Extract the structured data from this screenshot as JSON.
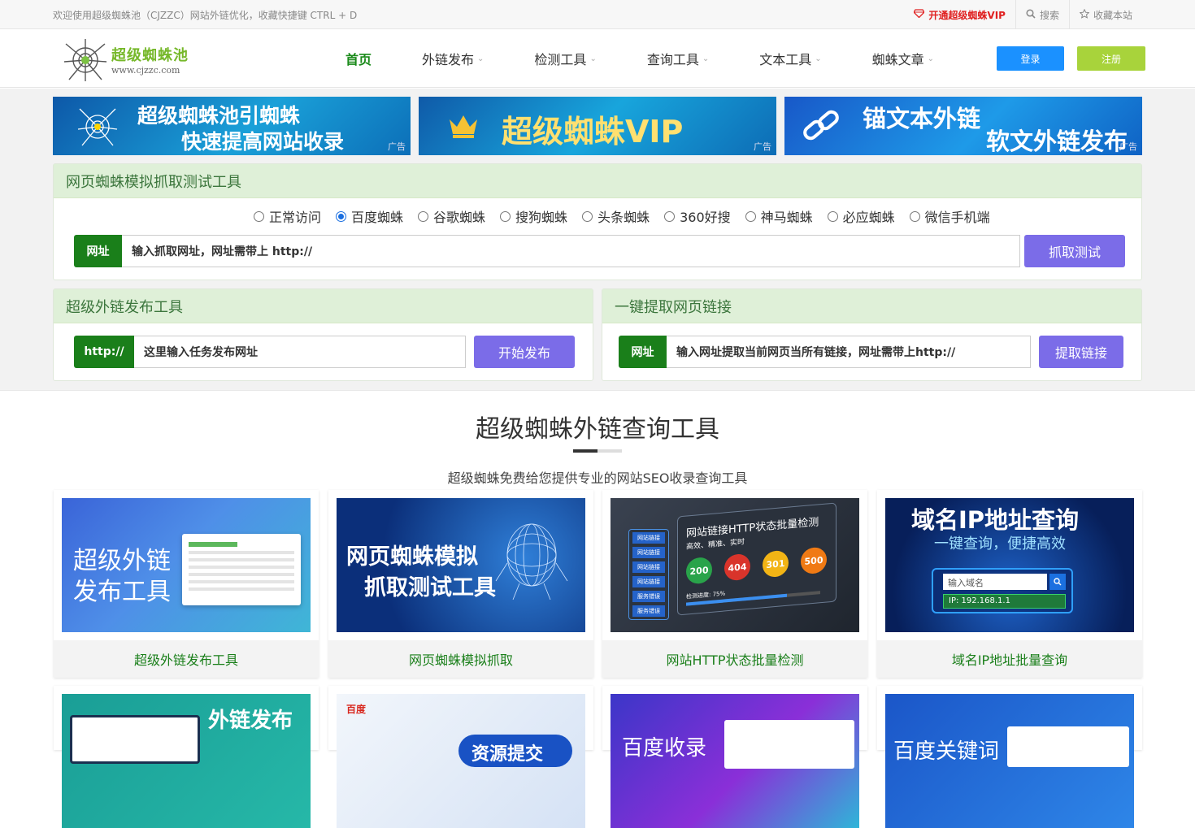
{
  "topbar": {
    "welcome": "欢迎使用超级蜘蛛池（CJZZC）网站外链优化，收藏快捷键 CTRL + D",
    "vip": "开通超级蜘蛛VIP",
    "search": "搜索",
    "favorite": "收藏本站"
  },
  "logo": {
    "name": "超级蜘蛛池",
    "domain": "www.cjzzc.com"
  },
  "nav": [
    {
      "label": "首页",
      "active": true
    },
    {
      "label": "外链发布"
    },
    {
      "label": "检测工具"
    },
    {
      "label": "查询工具"
    },
    {
      "label": "文本工具"
    },
    {
      "label": "蜘蛛文章"
    }
  ],
  "auth": {
    "login": "登录",
    "register": "注册"
  },
  "banners": [
    {
      "line1": "超级蜘蛛池引蜘蛛",
      "line2": "快速提高网站收录",
      "ad": "广告"
    },
    {
      "line1": "超级蜘蛛VIP",
      "ad": "广告"
    },
    {
      "line1": "锚文本外链",
      "line2": "软文外链发布",
      "ad": "广告"
    }
  ],
  "crawl_panel": {
    "title": "网页蜘蛛模拟抓取测试工具",
    "options": [
      "正常访问",
      "百度蜘蛛",
      "谷歌蜘蛛",
      "搜狗蜘蛛",
      "头条蜘蛛",
      "360好搜",
      "神马蜘蛛",
      "必应蜘蛛",
      "微信手机端"
    ],
    "selected_index": 1,
    "input_label": "网址",
    "placeholder": "输入抓取网址，网址需带上 http://",
    "button": "抓取测试"
  },
  "publish_panel": {
    "title": "超级外链发布工具",
    "input_label": "http://",
    "placeholder": "这里输入任务发布网址",
    "button": "开始发布"
  },
  "extract_panel": {
    "title": "一键提取网页链接",
    "input_label": "网址",
    "placeholder": "输入网址提取当前网页当所有链接，网址需带上http://",
    "button": "提取链接"
  },
  "section": {
    "title": "超级蜘蛛外链查询工具",
    "subtitle": "超级蜘蛛免费给您提供专业的网站SEO收录查询工具"
  },
  "cards": [
    {
      "caption": "超级外链发布工具",
      "img_line1": "超级外链",
      "img_line2": "发布工具"
    },
    {
      "caption": "网页蜘蛛模拟抓取",
      "img_line1": "网页蜘蛛模拟",
      "img_line2": "抓取测试工具"
    },
    {
      "caption": "网站HTTP状态批量检测",
      "img_title": "网站链接HTTP状态批量检测",
      "img_sub": "高效、精准、实时",
      "codes": [
        "200",
        "404",
        "301",
        "500"
      ],
      "progress_label": "检测进度: 75%",
      "progress": 0.75,
      "side_items": [
        "网站链接",
        "网站链接",
        "网站链接",
        "网站链接",
        "服务错误",
        "服务错误"
      ]
    },
    {
      "caption": "域名IP地址批量查询",
      "img_line1": "域名IP地址查询",
      "img_line2": "一键查询，便捷高效",
      "img_input": "输入域名",
      "img_ip": "IP: 192.168.1.1"
    }
  ],
  "cards_row2": [
    {
      "img_line1": "外链发布"
    },
    {
      "img_brand": "百度",
      "img_line1": "资源提交"
    },
    {
      "img_line1": "百度收录"
    },
    {
      "img_line1": "百度关键词"
    }
  ]
}
